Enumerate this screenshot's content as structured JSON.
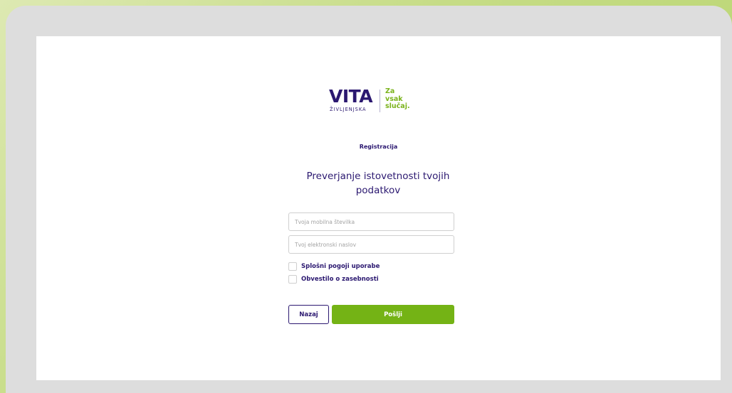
{
  "logo": {
    "brand": "VITA",
    "subtitle": "ŽIVLJENJSKA",
    "tagline": [
      "Za",
      "vsak",
      "slučaj."
    ]
  },
  "form": {
    "section_label": "Registracija",
    "title": "Preverjanje istovetnosti tvojih podatkov",
    "phone_placeholder": "Tvoja mobilna številka",
    "phone_value": "",
    "email_placeholder": "Tvoj elektronski naslov",
    "email_value": "",
    "checkboxes": [
      {
        "label": "Splošni pogoji uporabe",
        "checked": false
      },
      {
        "label": "Obvestilo o zasebnosti",
        "checked": false
      }
    ],
    "back_label": "Nazaj",
    "submit_label": "Pošlji"
  },
  "colors": {
    "brand_purple": "#2b1870",
    "brand_green": "#74b315",
    "frame_gray": "#dddddd",
    "background_green": "#c6dc86"
  }
}
